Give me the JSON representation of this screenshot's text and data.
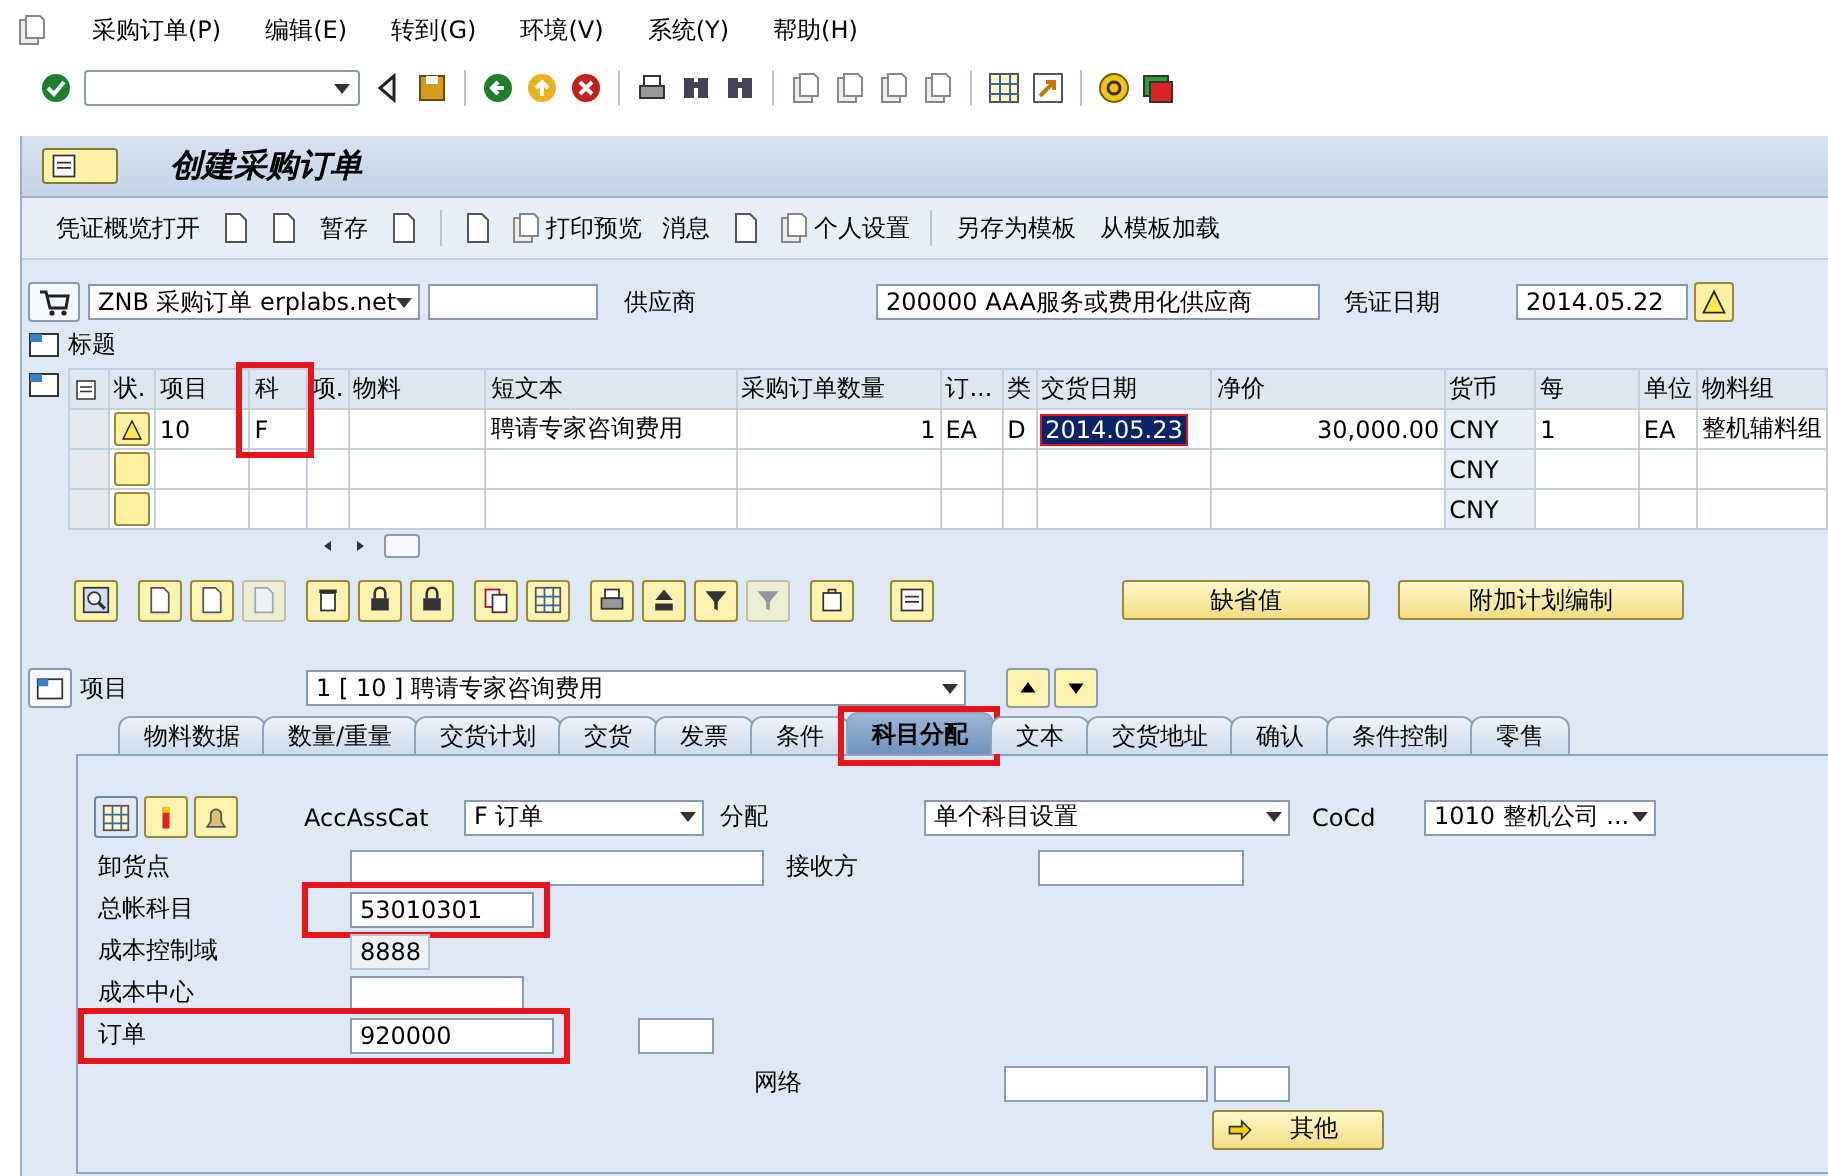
{
  "menu_bar": {
    "items": [
      "采购订单(P)",
      "编辑(E)",
      "转到(G)",
      "环境(V)",
      "系统(Y)",
      "帮助(H)"
    ]
  },
  "title_bar": {
    "title": "创建采购订单"
  },
  "app_toolbar": {
    "items": [
      {
        "kind": "text",
        "label": "凭证概览打开"
      },
      {
        "kind": "icon"
      },
      {
        "kind": "icon"
      },
      {
        "kind": "text",
        "label": "暂存"
      },
      {
        "kind": "icon"
      },
      {
        "kind": "separator"
      },
      {
        "kind": "icon"
      },
      {
        "kind": "icon_text",
        "label": "打印预览"
      },
      {
        "kind": "text",
        "label": "消息"
      },
      {
        "kind": "icon"
      },
      {
        "kind": "icon_text",
        "label": "个人设置"
      },
      {
        "kind": "separator"
      },
      {
        "kind": "text",
        "label": "另存为模板"
      },
      {
        "kind": "text",
        "label": "从模板加载"
      }
    ]
  },
  "header": {
    "order_type": "ZNB 采购订单 erplabs.net",
    "vendor_label": "供应商",
    "vendor": "200000 AAA服务或费用化供应商",
    "doc_date_label": "凭证日期",
    "doc_date": "2014.05.22",
    "header_section": "标题"
  },
  "table": {
    "columns": [
      {
        "label": "状.",
        "highlighted": false
      },
      {
        "label": "项目",
        "highlighted": false
      },
      {
        "label": "科",
        "highlighted": true
      },
      {
        "label": "项.",
        "highlighted": false
      },
      {
        "label": "物料",
        "highlighted": false
      },
      {
        "label": "短文本",
        "highlighted": false
      },
      {
        "label": "采购订单数量",
        "highlighted": false
      },
      {
        "label": "订...",
        "highlighted": false
      },
      {
        "label": "类",
        "highlighted": false
      },
      {
        "label": "交货日期",
        "highlighted": false
      },
      {
        "label": "净价",
        "highlighted": false
      },
      {
        "label": "货币",
        "highlighted": false
      },
      {
        "label": "每",
        "highlighted": false
      },
      {
        "label": "单位",
        "highlighted": false
      },
      {
        "label": "物料组",
        "highlighted": false
      }
    ],
    "rows": [
      {
        "status_warning": true,
        "item": "10",
        "acct": "F",
        "short_text": "聘请专家咨询费用",
        "quantity": "1",
        "order_unit": "EA",
        "item_cat": "D",
        "delivery_date": "2014.05.23",
        "date_selected": true,
        "net_price": "30,000.00",
        "currency": "CNY",
        "per": "1",
        "unit": "EA",
        "material_group": "整机辅料组"
      },
      {
        "status_warning": false,
        "currency": "CNY"
      },
      {
        "status_warning": false,
        "currency": "CNY"
      }
    ]
  },
  "table_buttons": [
    "缺省值",
    "附加计划编制"
  ],
  "item_selector": {
    "label": "项目",
    "value": "1 [ 10 ] 聘请专家咨询费用"
  },
  "tabs": [
    {
      "label": "物料数据",
      "selected": false,
      "highlighted": false
    },
    {
      "label": "数量/重量",
      "selected": false,
      "highlighted": false
    },
    {
      "label": "交货计划",
      "selected": false,
      "highlighted": false
    },
    {
      "label": "交货",
      "selected": false,
      "highlighted": false
    },
    {
      "label": "发票",
      "selected": false,
      "highlighted": false
    },
    {
      "label": "条件",
      "selected": false,
      "highlighted": false
    },
    {
      "label": "科目分配",
      "selected": true,
      "highlighted": true
    },
    {
      "label": "文本",
      "selected": false,
      "highlighted": false
    },
    {
      "label": "交货地址",
      "selected": false,
      "highlighted": false
    },
    {
      "label": "确认",
      "selected": false,
      "highlighted": false
    },
    {
      "label": "条件控制",
      "selected": false,
      "highlighted": false
    },
    {
      "label": "零售",
      "selected": false,
      "highlighted": false
    }
  ],
  "account_assignment": {
    "acc_ass_cat": {
      "label": "AccAssCat",
      "value": "F 订单"
    },
    "distribution": {
      "label": "分配",
      "value": "单个科目设置"
    },
    "company_code": {
      "label": "CoCd",
      "value": "1010 整机公司 ..."
    },
    "unloading_point": {
      "label": "卸货点"
    },
    "recipient": {
      "label": "接收方"
    },
    "gl_account": {
      "label": "总帐科目",
      "value": "53010301",
      "highlighted": true
    },
    "controlling_area": {
      "label": "成本控制域",
      "value": "8888"
    },
    "cost_center": {
      "label": "成本中心"
    },
    "order": {
      "label": "订单",
      "value": "920000",
      "highlighted": true
    },
    "network": {
      "label": "网络"
    },
    "more_button": "其他"
  }
}
